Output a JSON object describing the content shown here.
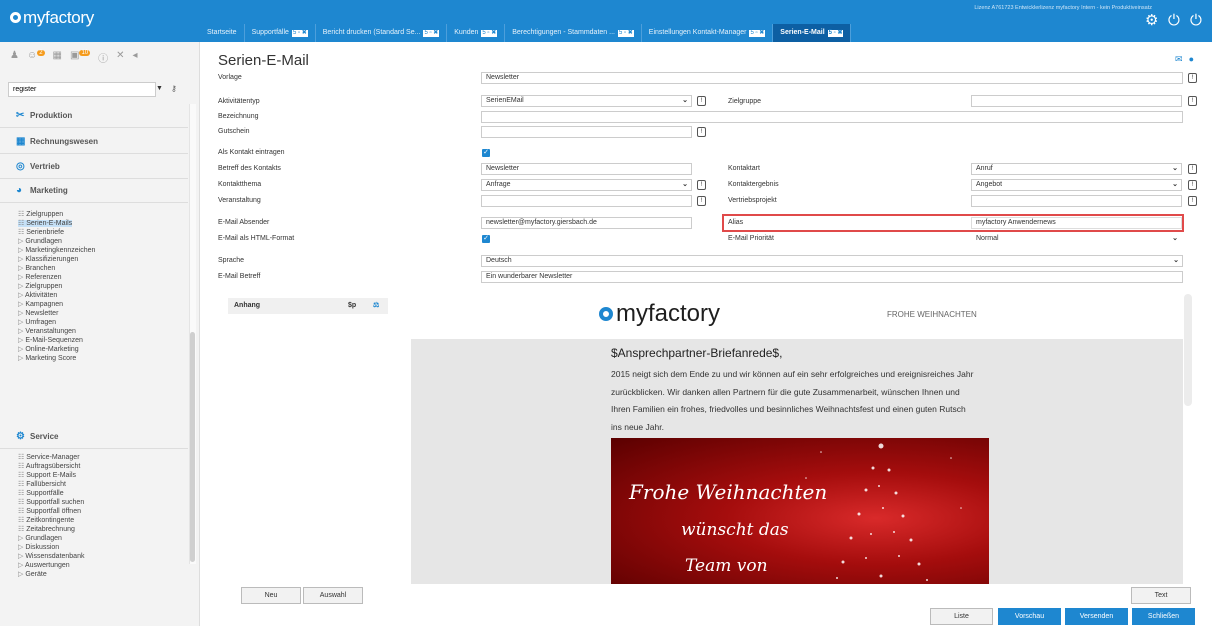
{
  "app": {
    "logo": "myfactory",
    "license": "Lizenz A761723 Entwicklerlizenz myfactory Intern - kein Produktiveinsatz"
  },
  "tabs": [
    {
      "label": "Startseite"
    },
    {
      "label": "Supportfälle"
    },
    {
      "label": "Bericht drucken (Standard Se..."
    },
    {
      "label": "Kunden"
    },
    {
      "label": "Berechtigungen - Stammdaten ..."
    },
    {
      "label": "Einstellungen Kontakt-Manager"
    },
    {
      "label": "Serien-E-Mail"
    }
  ],
  "tab_ctl": "5 ▫ ✖",
  "sidebar": {
    "badge1": "2",
    "badge2": "10",
    "search_value": "register",
    "sections": {
      "produktion": "Produktion",
      "rechnungswesen": "Rechnungswesen",
      "vertrieb": "Vertrieb",
      "marketing": "Marketing",
      "service": "Service"
    },
    "marketing_items": [
      "Zielgruppen",
      "Serien-E-Mails",
      "Serienbriefe",
      "Grundlagen",
      "Marketingkennzeichen",
      "Klassifizierungen",
      "Branchen",
      "Referenzen",
      "Zielgruppen",
      "Aktivitäten",
      "Kampagnen",
      "Newsletter",
      "Umfragen",
      "Veranstaltungen",
      "E-Mail-Sequenzen",
      "Online-Marketing",
      "Marketing Score"
    ],
    "service_items": [
      "Service-Manager",
      "Auftragsübersicht",
      "Support E-Mails",
      "Fallübersicht",
      "Supportfälle",
      "Supportfall suchen",
      "Supportfall öffnen",
      "Zeitkontingente",
      "Zeitabrechnung",
      "Grundlagen",
      "Diskussion",
      "Wissensdatenbank",
      "Auswertungen",
      "Geräte"
    ]
  },
  "form": {
    "title": "Serien-E-Mail",
    "vorlage_label": "Vorlage",
    "vorlage_value": "Newsletter",
    "aktivitaetentyp_label": "Aktivitätentyp",
    "aktivitaetentyp_value": "SerienEMail",
    "zielgruppe_label": "Zielgruppe",
    "zielgruppe_value": "",
    "bezeichnung_label": "Bezeichnung",
    "bezeichnung_value": "",
    "gutschein_label": "Gutschein",
    "gutschein_value": "",
    "als_kontakt_label": "Als Kontakt eintragen",
    "betreff_kontakt_label": "Betreff des Kontakts",
    "betreff_kontakt_value": "Newsletter",
    "kontaktart_label": "Kontaktart",
    "kontaktart_value": "Anruf",
    "kontaktthema_label": "Kontaktthema",
    "kontaktthema_value": "Anfrage",
    "kontaktergebnis_label": "Kontaktergebnis",
    "kontaktergebnis_value": "Angebot",
    "veranstaltung_label": "Veranstaltung",
    "veranstaltung_value": "",
    "vertriebsprojekt_label": "Vertriebsprojekt",
    "vertriebsprojekt_value": "",
    "absender_label": "E-Mail Absender",
    "absender_value": "newsletter@myfactory.giersbach.de",
    "alias_label": "Alias",
    "alias_value": "myfactory Anwendernews",
    "html_label": "E-Mail als HTML-Format",
    "prioritaet_label": "E-Mail Priorität",
    "prioritaet_value": "Normal",
    "sprache_label": "Sprache",
    "sprache_value": "Deutsch",
    "betreff_label": "E-Mail Betreff",
    "betreff_value": "Ein wunderbarer Newsletter"
  },
  "attachments": {
    "header": "Anhang",
    "col": "$p"
  },
  "preview": {
    "logo": "myfactory",
    "greeting": "FROHE WEIHNACHTEN",
    "salutation": "$Ansprechpartner-Briefanrede$,",
    "body": "2015 neigt sich dem Ende zu und wir können auf ein sehr erfolgreiches und ereignisreiches Jahr zurückblicken. Wir danken allen Partnern für die gute Zusammenarbeit, wünschen Ihnen und Ihren Familien ein frohes, friedvolles und besinnliches Weihnachtsfest und einen guten Rutsch ins neue Jahr.",
    "img_line1": "Frohe Weihnachten",
    "img_line2": "wünscht das",
    "img_line3": "Team von"
  },
  "buttons": {
    "neu": "Neu",
    "auswahl": "Auswahl",
    "text": "Text",
    "liste": "Liste",
    "vorschau": "Vorschau",
    "versenden": "Versenden",
    "schliessen": "Schließen"
  },
  "colors": {
    "brand": "#1e87d0",
    "highlight": "#e04a4a"
  }
}
